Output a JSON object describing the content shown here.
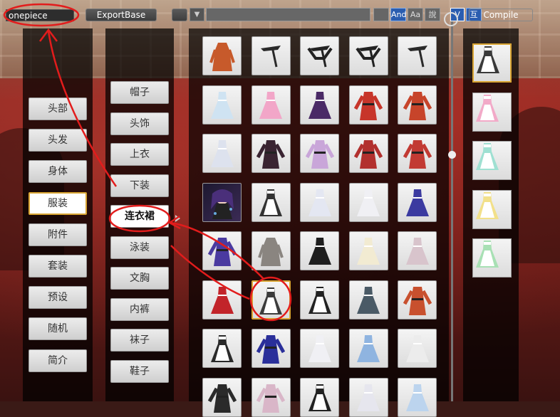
{
  "topbar": {
    "search_value": "onepiece",
    "export_label": "ExportBase",
    "btn_and": "And",
    "btn_aa": "Aa",
    "btn_shuo": "說",
    "btn_v": "V",
    "btn_hu": "互",
    "compile_label": "Compile"
  },
  "categories": [
    "头部",
    "头发",
    "身体",
    "服装",
    "附件",
    "套装",
    "预设",
    "随机",
    "简介"
  ],
  "selected_category": "服装",
  "subcategories": [
    "帽子",
    "头饰",
    "上衣",
    "下装",
    "连衣裙",
    "泳装",
    "文胸",
    "内裤",
    "袜子",
    "鞋子"
  ],
  "selected_subcategory": "连衣裙",
  "grid_items": [
    {
      "color": "#c75a2b",
      "kind": "coat"
    },
    {
      "color": "#2a2a2a",
      "kind": "strap"
    },
    {
      "color": "#222",
      "kind": "strap2"
    },
    {
      "color": "#222",
      "kind": "strap2"
    },
    {
      "color": "#2a2a2a",
      "kind": "strap"
    },
    {
      "color": "#cfe3f2",
      "kind": "dress"
    },
    {
      "color": "#f2a6c8",
      "kind": "dress"
    },
    {
      "color": "#4a2a66",
      "kind": "dress"
    },
    {
      "color": "#c7352a",
      "kind": "robe"
    },
    {
      "color": "#c7442a",
      "kind": "robe"
    },
    {
      "color": "#dde2ee",
      "kind": "dress"
    },
    {
      "color": "#3a2432",
      "kind": "robe"
    },
    {
      "color": "#c9a6d9",
      "kind": "robe"
    },
    {
      "color": "#b2302e",
      "kind": "robe"
    },
    {
      "color": "#c23a33",
      "kind": "robe"
    },
    {
      "color": "#4a2f7a",
      "kind": "avatar"
    },
    {
      "color": "#333",
      "kind": "apron"
    },
    {
      "color": "#e4e7f2",
      "kind": "dress"
    },
    {
      "color": "#f0f0f4",
      "kind": "dress"
    },
    {
      "color": "#3b3aa0",
      "kind": "dress"
    },
    {
      "color": "#4a3aa0",
      "kind": "robe"
    },
    {
      "color": "#8a8580",
      "kind": "coat"
    },
    {
      "color": "#1e1e1e",
      "kind": "dress"
    },
    {
      "color": "#f2ebd2",
      "kind": "dress"
    },
    {
      "color": "#d8c4cc",
      "kind": "dress"
    },
    {
      "color": "#c2242a",
      "kind": "dress"
    },
    {
      "color": "#3b3b3b",
      "kind": "maid"
    },
    {
      "color": "#222",
      "kind": "maid"
    },
    {
      "color": "#4a5a66",
      "kind": "dress"
    },
    {
      "color": "#c8502e",
      "kind": "robe"
    },
    {
      "color": "#2a2a2a",
      "kind": "apron"
    },
    {
      "color": "#2a2f9a",
      "kind": "robe"
    },
    {
      "color": "#f0f0f4",
      "kind": "dress"
    },
    {
      "color": "#8fb4e0",
      "kind": "dress"
    },
    {
      "color": "#ececec",
      "kind": "dress"
    },
    {
      "color": "#2a2a2a",
      "kind": "robe"
    },
    {
      "color": "#d9b6c8",
      "kind": "robe"
    },
    {
      "color": "#222",
      "kind": "maid"
    },
    {
      "color": "#e6e6ee",
      "kind": "dress"
    },
    {
      "color": "#bcd4ee",
      "kind": "dress"
    }
  ],
  "selected_grid_index": 26,
  "side_items": [
    {
      "color": "#3a3a3a",
      "kind": "maid"
    },
    {
      "color": "#f2aac8",
      "kind": "maid"
    },
    {
      "color": "#9fe0d2",
      "kind": "maid"
    },
    {
      "color": "#f2e08a",
      "kind": "maid"
    },
    {
      "color": "#a8e0b4",
      "kind": "maid"
    }
  ],
  "selected_side_index": 0,
  "colors": {
    "accent": "#d9a533",
    "annotation": "#e21c1c"
  }
}
